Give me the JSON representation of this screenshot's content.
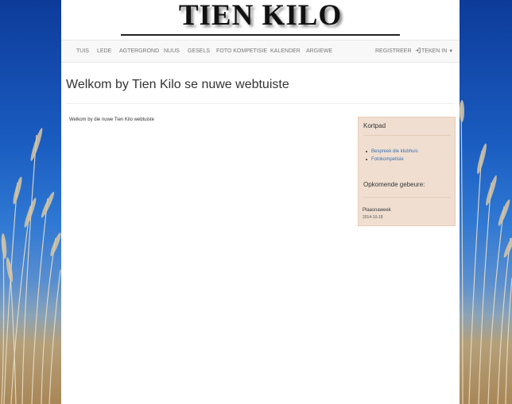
{
  "site": {
    "logo_text": "TIEN KILO"
  },
  "navbar": {
    "items": [
      {
        "label": "TUIS"
      },
      {
        "label": "LEDE"
      },
      {
        "label": "AGTERGROND"
      },
      {
        "label": "NUUS"
      },
      {
        "label": "GESELS"
      },
      {
        "label": "FOTO KOMPETISIE"
      },
      {
        "label": "KALENDER"
      },
      {
        "label": "ARGIEWE"
      }
    ],
    "register_label": "REGISTREER",
    "login_label": "TEKEN IN",
    "login_icon": "login-icon",
    "caret_icon": "caret-down-icon"
  },
  "main": {
    "title": "Welkom by Tien Kilo se nuwe webtuiste",
    "body_text": "Welkom by die nuwe Tien Kilo webtuiste"
  },
  "sidebar": {
    "shortcuts_heading": "Kortpad",
    "links": [
      {
        "label": "Bespreek die klubhuis"
      },
      {
        "label": "Fotokompetisie"
      }
    ],
    "events_heading": "Opkomende gebeure:",
    "events": [
      {
        "name": "Plaasnaweek",
        "date": "2014-10-18"
      }
    ]
  },
  "colors": {
    "sky": "#1a5cc0",
    "reeds": "#b59f79",
    "navbar_bg": "#f8f8f8",
    "sidebar_bg": "#f0dfd1",
    "link": "#3a6fb0"
  }
}
